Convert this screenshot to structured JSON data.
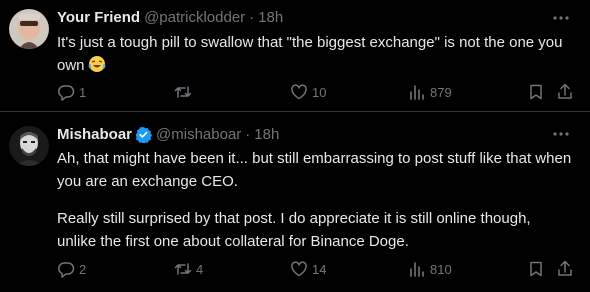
{
  "tweets": [
    {
      "display_name": "Your Friend",
      "handle": "@patricklodder",
      "separator": "·",
      "time": "18h",
      "verified": false,
      "text_lines": [
        "It's just a tough pill to swallow that \"the biggest exchange\" is not the one you own"
      ],
      "emoji": "laughing-tears-emoji",
      "replies": "1",
      "retweets": "",
      "likes": "10",
      "views": "879"
    },
    {
      "display_name": "Mishaboar",
      "handle": "@mishaboar",
      "separator": "·",
      "time": "18h",
      "verified": true,
      "paragraph1": "Ah, that might have been it... but still embarrassing to post stuff like that when you are an exchange CEO.",
      "paragraph2": "Really still surprised by that post. I do appreciate it is still online though, unlike the first one about collateral for Binance Doge.",
      "replies": "2",
      "retweets": "4",
      "likes": "14",
      "views": "810"
    }
  ],
  "colors": {
    "background": "#000000",
    "text": "#e7e9ea",
    "muted": "#71767b",
    "verified": "#1d9bf0",
    "divider": "#2f3336"
  },
  "icons": [
    "more-icon",
    "reply-icon",
    "retweet-icon",
    "like-icon",
    "views-icon",
    "bookmark-icon",
    "share-icon",
    "verified-badge-icon"
  ]
}
